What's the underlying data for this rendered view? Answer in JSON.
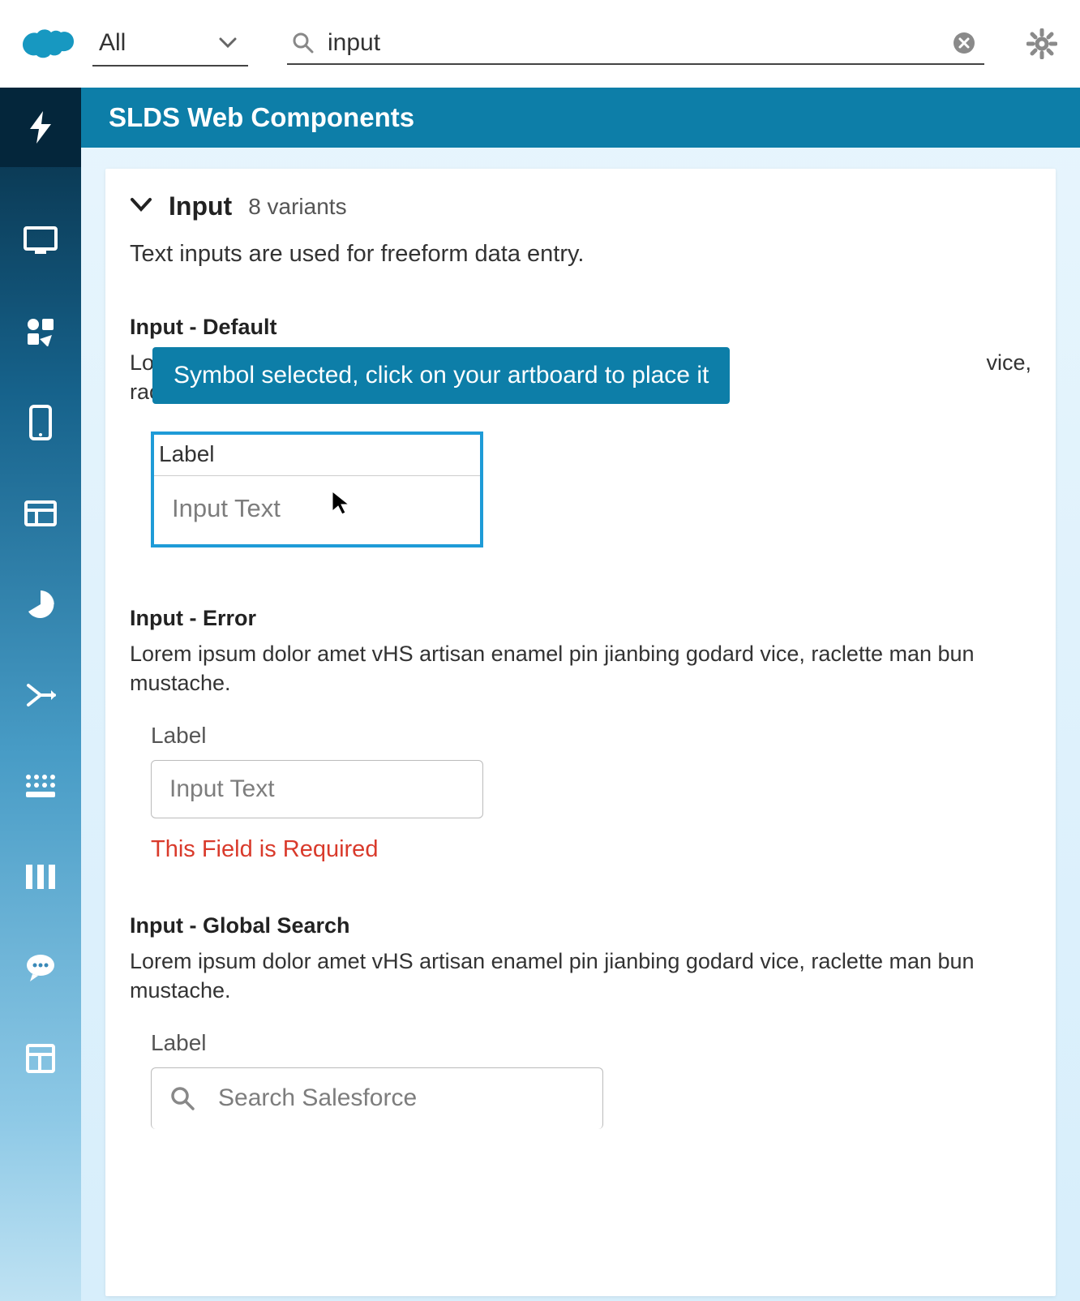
{
  "header": {
    "filter_label": "All",
    "search_value": "input",
    "page_title": "SLDS Web Components"
  },
  "component": {
    "title": "Input",
    "variant_count": "8 variants",
    "description": "Text inputs are used for freeform data entry."
  },
  "tooltip": "Symbol selected, click on your artboard to place it",
  "variants": {
    "default": {
      "title": "Input - Default",
      "desc_prefix": "Lo",
      "desc_suffix": "rac",
      "desc_tail": "vice,",
      "label": "Label",
      "placeholder": "Input Text"
    },
    "error": {
      "title": "Input - Error",
      "description": "Lorem ipsum dolor amet vHS artisan enamel pin jianbing godard vice, raclette man bun mustache.",
      "label": "Label",
      "placeholder": "Input Text",
      "error_message": "This Field is Required"
    },
    "search": {
      "title": "Input - Global Search",
      "description": "Lorem ipsum dolor amet vHS artisan enamel pin jianbing godard vice, raclette man bun mustache.",
      "label": "Label",
      "placeholder": "Search Salesforce"
    }
  }
}
